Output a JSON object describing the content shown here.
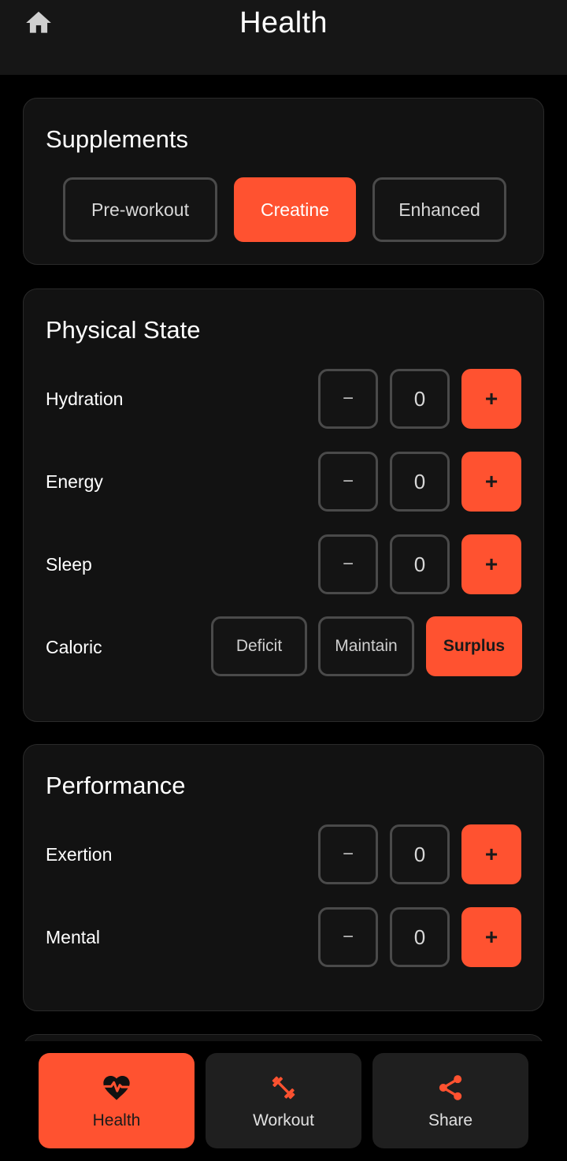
{
  "header": {
    "title": "Health",
    "home_icon": "home-icon"
  },
  "supplements": {
    "title": "Supplements",
    "options": [
      {
        "label": "Pre-workout",
        "active": false
      },
      {
        "label": "Creatine",
        "active": true
      },
      {
        "label": "Enhanced",
        "active": false
      }
    ]
  },
  "physical": {
    "title": "Physical State",
    "rows": [
      {
        "label": "Hydration",
        "minus": "−",
        "value": "0",
        "plus": "+"
      },
      {
        "label": "Energy",
        "minus": "−",
        "value": "0",
        "plus": "+"
      },
      {
        "label": "Sleep",
        "minus": "−",
        "value": "0",
        "plus": "+"
      }
    ],
    "caloric": {
      "label": "Caloric",
      "options": [
        {
          "label": "Deficit",
          "active": false
        },
        {
          "label": "Maintain",
          "active": false
        },
        {
          "label": "Surplus",
          "active": true
        }
      ]
    }
  },
  "performance": {
    "title": "Performance",
    "rows": [
      {
        "label": "Exertion",
        "minus": "−",
        "value": "0",
        "plus": "+"
      },
      {
        "label": "Mental",
        "minus": "−",
        "value": "0",
        "plus": "+"
      }
    ]
  },
  "nav": {
    "items": [
      {
        "label": "Health",
        "icon": "heart-pulse-icon",
        "active": true
      },
      {
        "label": "Workout",
        "icon": "dumbbell-icon",
        "active": false
      },
      {
        "label": "Share",
        "icon": "share-icon",
        "active": false
      }
    ]
  },
  "colors": {
    "accent": "#ff5230",
    "background": "#000000",
    "card": "#121212"
  }
}
